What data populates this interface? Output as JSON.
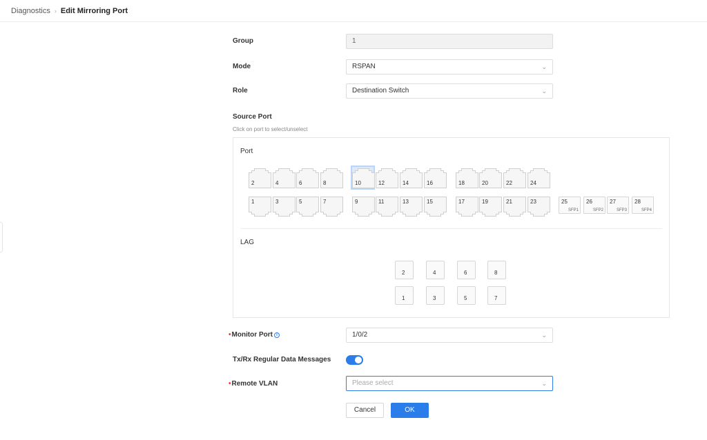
{
  "breadcrumb": {
    "parent": "Diagnostics",
    "separator": "›",
    "current": "Edit Mirroring Port"
  },
  "form": {
    "group": {
      "label": "Group",
      "value": "1"
    },
    "mode": {
      "label": "Mode",
      "value": "RSPAN"
    },
    "role": {
      "label": "Role",
      "value": "Destination Switch"
    },
    "source_port": {
      "label": "Source Port",
      "hint": "Click on port to select/unselect"
    },
    "monitor_port": {
      "required_mark": "•",
      "label": "Monitor Port",
      "info": "i",
      "value": "1/0/2"
    },
    "txrx": {
      "label": "Tx/Rx Regular Data Messages",
      "enabled": true
    },
    "remote_vlan": {
      "required_mark": "•",
      "label": "Remote VLAN",
      "placeholder": "Please select"
    }
  },
  "port_panel": {
    "port_title": "Port",
    "lag_title": "LAG",
    "selected_port": "10",
    "top_ports": [
      "2",
      "4",
      "6",
      "8",
      "10",
      "12",
      "14",
      "16",
      "18",
      "20",
      "22",
      "24"
    ],
    "bottom_ports": [
      "1",
      "3",
      "5",
      "7",
      "9",
      "11",
      "13",
      "15",
      "17",
      "19",
      "21",
      "23"
    ],
    "sfp_ports": [
      {
        "num": "25",
        "tag": "SFP1"
      },
      {
        "num": "26",
        "tag": "SFP2"
      },
      {
        "num": "27",
        "tag": "SFP3"
      },
      {
        "num": "28",
        "tag": "SFP4"
      }
    ],
    "lag_top": [
      "2",
      "4",
      "6",
      "8"
    ],
    "lag_bottom": [
      "1",
      "3",
      "5",
      "7"
    ]
  },
  "buttons": {
    "cancel": "Cancel",
    "ok": "OK"
  },
  "colors": {
    "accent": "#2b7de9",
    "required": "#e33333",
    "selected_bg": "#dce9fb"
  },
  "icons": {
    "chevron": "chevron-down-icon",
    "info": "info-icon",
    "breadcrumb_sep": "chevron-right-icon"
  }
}
